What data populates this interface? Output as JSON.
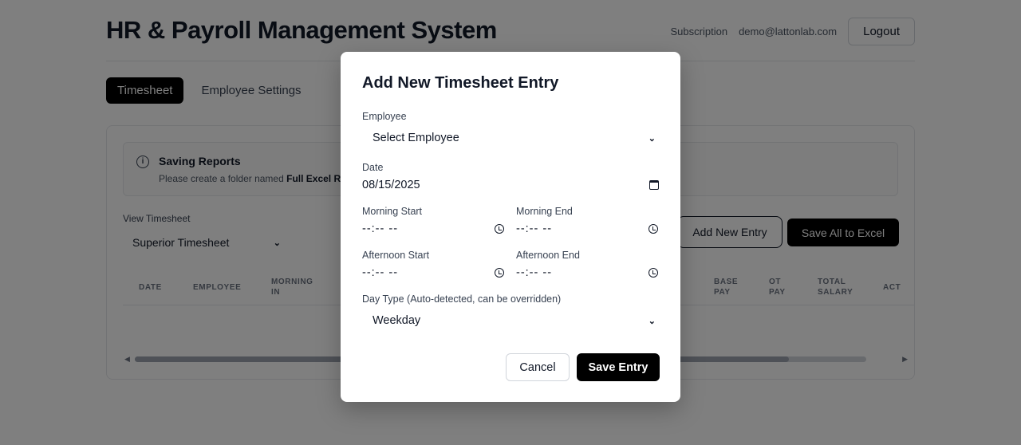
{
  "header": {
    "title": "HR & Payroll Management System",
    "subscription": "Subscription",
    "email": "demo@lattonlab.com",
    "logout": "Logout"
  },
  "tabs": [
    {
      "label": "Timesheet",
      "active": true
    },
    {
      "label": "Employee Settings",
      "active": false
    }
  ],
  "notice": {
    "icon": "info-icon",
    "icon_glyph": "i",
    "title": "Saving Reports",
    "text": "Please create a folder named ",
    "text_bold": "Full Excel Re"
  },
  "view": {
    "label": "View Timesheet",
    "selected": "Superior Timesheet"
  },
  "actions": {
    "add_entry": "Add New Entry",
    "save_all": "Save All to Excel"
  },
  "table": {
    "columns_left": [
      "DATE",
      "EMPLOYEE",
      "MORNING\nIN"
    ],
    "columns_right": [
      "BASE\nPAY",
      "OT\nPAY",
      "TOTAL\nSALARY",
      "ACT"
    ]
  },
  "modal": {
    "title": "Add New Timesheet Entry",
    "employee_label": "Employee",
    "employee_value": "Select Employee",
    "date_label": "Date",
    "date_value": "08/15/2025",
    "morning_start_label": "Morning Start",
    "morning_start_value": "--:-- --",
    "morning_end_label": "Morning End",
    "morning_end_value": "--:-- --",
    "afternoon_start_label": "Afternoon Start",
    "afternoon_start_value": "--:-- --",
    "afternoon_end_label": "Afternoon End",
    "afternoon_end_value": "--:-- --",
    "day_type_label": "Day Type (Auto-detected, can be overridden)",
    "day_type_value": "Weekday",
    "cancel": "Cancel",
    "save": "Save Entry"
  },
  "colors": {
    "overlay": "rgba(0,0,0,0.5)",
    "primary": "#000000",
    "text": "#111827",
    "border": "#e5e7eb"
  }
}
